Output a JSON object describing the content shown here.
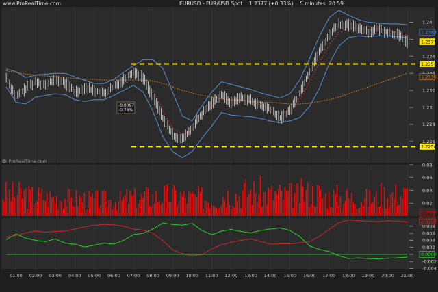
{
  "header": {
    "brand": "www.ProRealTime.com",
    "instrument": "EURUSD - EUR/USD Spot",
    "last_price_change": "1.2377 (+0.33%)",
    "timeframe": "5 minutes",
    "clock": "20:59"
  },
  "watermark": "© ProRealTime.com",
  "colors": {
    "background": "#1e1e1e",
    "panel": "#2b2b2b",
    "price_bars": "#cfcfcf",
    "bollinger": "#5b8fd8",
    "moving_average": "#c97a20",
    "signal_line": "#c83a3a",
    "support_resistance": "#ffe600",
    "volume": "#e01010",
    "green_line": "#2bd12b",
    "red_line": "#c82a2a"
  },
  "icons": [
    "prorealtime-logo"
  ],
  "chart_data": [
    {
      "type": "line",
      "panel": "price",
      "title": "EURUSD - EUR/USD Spot",
      "ylim": [
        1.2235,
        1.2418
      ],
      "yticks": [
        1.226,
        1.228,
        1.23,
        1.232,
        1.234,
        1.236,
        1.238,
        1.24
      ],
      "ytick_labels": [
        "1.226",
        "1.228",
        "1.23",
        "1.232",
        "1.234",
        "1.236",
        "1.238",
        "1.24"
      ],
      "x_labels": [
        "01:00",
        "02:00",
        "03:00",
        "04:00",
        "05:00",
        "06:00",
        "07:00",
        "08:00",
        "09:00",
        "10:00",
        "11:00",
        "12:00",
        "13:00",
        "14:00",
        "15:00",
        "16:00",
        "17:00",
        "18:00",
        "19:00",
        "20:00",
        "21:00"
      ],
      "hours": [
        0.5,
        1,
        1.5,
        2,
        2.5,
        3,
        3.5,
        4,
        4.5,
        5,
        5.5,
        6,
        6.5,
        7,
        7.5,
        8,
        8.5,
        9,
        9.5,
        10,
        10.5,
        11,
        11.5,
        12,
        12.5,
        13,
        13.5,
        14,
        14.5,
        15,
        15.5,
        16,
        16.5,
        17,
        17.5,
        18,
        18.5,
        19,
        19.5,
        20,
        20.5,
        21
      ],
      "series": [
        {
          "kind": "price",
          "values": [
            1.2335,
            1.2312,
            1.2322,
            1.2331,
            1.2326,
            1.2333,
            1.2329,
            1.2318,
            1.2323,
            1.232,
            1.2316,
            1.2324,
            1.2333,
            1.2342,
            1.2335,
            1.2312,
            1.2288,
            1.2268,
            1.2262,
            1.2276,
            1.2292,
            1.2305,
            1.2315,
            1.2305,
            1.2312,
            1.2308,
            1.2302,
            1.2298,
            1.2287,
            1.2296,
            1.2317,
            1.2342,
            1.2365,
            1.2385,
            1.2398,
            1.2396,
            1.2394,
            1.2389,
            1.2392,
            1.2388,
            1.2385,
            1.2377
          ]
        },
        {
          "kind": "bollinger-upper",
          "values": [
            1.2345,
            1.2342,
            1.2335,
            1.2338,
            1.2339,
            1.234,
            1.234,
            1.2336,
            1.2332,
            1.2328,
            1.2328,
            1.2333,
            1.2341,
            1.2349,
            1.2356,
            1.2356,
            1.2346,
            1.2318,
            1.229,
            1.2284,
            1.2302,
            1.2318,
            1.233,
            1.2327,
            1.2324,
            1.2321,
            1.2317,
            1.2314,
            1.2311,
            1.2316,
            1.2332,
            1.2357,
            1.2383,
            1.2405,
            1.2414,
            1.2408,
            1.2403,
            1.24,
            1.2399,
            1.2398,
            1.2398,
            1.2397
          ]
        },
        {
          "kind": "bollinger-lower",
          "values": [
            1.2324,
            1.2306,
            1.2304,
            1.2312,
            1.2314,
            1.2316,
            1.2315,
            1.2309,
            1.2307,
            1.2309,
            1.2309,
            1.2314,
            1.232,
            1.2326,
            1.2318,
            1.2295,
            1.2266,
            1.2248,
            1.2241,
            1.2248,
            1.2264,
            1.2278,
            1.2294,
            1.2291,
            1.229,
            1.2289,
            1.2287,
            1.2284,
            1.2282,
            1.2284,
            1.2288,
            1.2301,
            1.2322,
            1.2351,
            1.2372,
            1.2382,
            1.2384,
            1.2383,
            1.2384,
            1.2384,
            1.2383,
            1.2382
          ]
        },
        {
          "kind": "moving-average",
          "values": [
            1.2343,
            1.2341,
            1.2339,
            1.2338,
            1.2337,
            1.2336,
            1.2335,
            1.2334,
            1.2333,
            1.2333,
            1.2332,
            1.2332,
            1.2332,
            1.2332,
            1.2332,
            1.2331,
            1.2328,
            1.2324,
            1.232,
            1.2317,
            1.2314,
            1.2312,
            1.231,
            1.2309,
            1.2308,
            1.2307,
            1.2306,
            1.2306,
            1.2305,
            1.2304,
            1.2304,
            1.2305,
            1.2307,
            1.2309,
            1.2312,
            1.2316,
            1.232,
            1.2324,
            1.2328,
            1.2332,
            1.2336,
            1.234
          ]
        },
        {
          "kind": "signal",
          "values": [
            null,
            null,
            null,
            null,
            null,
            null,
            null,
            null,
            null,
            null,
            null,
            null,
            null,
            null,
            null,
            1.2322,
            1.2296,
            1.2276,
            1.2268,
            1.2273,
            1.2288,
            1.2301,
            1.231,
            1.2308,
            1.2309,
            1.2307,
            1.2303,
            1.2298,
            1.2293,
            1.2296,
            1.2309,
            1.233,
            1.2352,
            1.2373,
            1.2388,
            1.2392,
            1.2393,
            1.2391,
            1.2392,
            1.239,
            1.2388,
            1.2385
          ]
        }
      ],
      "reference_lines": [
        {
          "value": 1.2351,
          "label": "1.2351"
        },
        {
          "value": 1.2254,
          "label": "1.2254"
        }
      ],
      "price_tags": [
        "1.2388",
        "1.2377",
        "1.2336"
      ],
      "annotation": {
        "hour": 7,
        "lines": [
          "-0.0097",
          "-0.78%"
        ]
      }
    },
    {
      "type": "bar",
      "panel": "volume",
      "ylim": [
        0,
        0.08
      ],
      "yticks": [
        0.02,
        0.04,
        0.06,
        0.08
      ],
      "ytick_labels": [
        "0.02",
        "0.04",
        "0.06",
        "0.08"
      ],
      "price_tag": "0.0066",
      "hour_values": [
        0.034,
        0.031,
        0.029,
        0.027,
        0.025,
        0.024,
        0.028,
        0.03,
        0.032,
        0.029,
        0.027,
        0.034,
        0.038,
        0.034,
        0.033,
        0.036,
        0.031,
        0.029,
        0.027,
        0.034
      ]
    },
    {
      "type": "line",
      "panel": "indicator",
      "ylim": [
        -0.0043,
        0.0103
      ],
      "yticks": [
        -0.004,
        -0.002,
        0,
        0.002,
        0.004,
        0.006,
        0.008
      ],
      "ytick_labels": [
        "-0.004",
        "-0.002",
        "0.000",
        "0.002",
        "0.004",
        "0.006",
        "0.008"
      ],
      "price_tags": [
        "0.0123",
        "0.0100",
        "0.0000"
      ],
      "hours": [
        0.5,
        1,
        1.5,
        2,
        2.5,
        3,
        3.5,
        4,
        4.5,
        5,
        5.5,
        6,
        6.5,
        7,
        7.5,
        8,
        8.5,
        9,
        9.5,
        10,
        10.5,
        11,
        11.5,
        12,
        12.5,
        13,
        13.5,
        14,
        14.5,
        15,
        15.5,
        16,
        16.5,
        17,
        17.5,
        18,
        18.5,
        19,
        19.5,
        20,
        20.5,
        21
      ],
      "series": [
        {
          "color_key": "green_line",
          "values": [
            0.0042,
            0.0058,
            0.0046,
            0.004,
            0.0036,
            0.0044,
            0.0032,
            0.0029,
            0.0021,
            0.0026,
            0.0032,
            0.0029,
            0.004,
            0.0056,
            0.006,
            0.0072,
            0.0089,
            0.0085,
            0.0083,
            0.0088,
            0.0068,
            0.0056,
            0.0066,
            0.0071,
            0.0065,
            0.0061,
            0.0068,
            0.0072,
            0.0075,
            0.0068,
            0.0051,
            0.0024,
            0.0014,
            0.0008,
            -0.0004,
            -0.0012,
            -0.001,
            -0.0012,
            -0.0013,
            -0.0011,
            -0.001,
            -0.0008
          ]
        },
        {
          "color_key": "red_line",
          "values": [
            0.0049,
            0.0054,
            0.0061,
            0.0066,
            0.0063,
            0.0065,
            0.0066,
            0.0072,
            0.0078,
            0.0083,
            0.0085,
            0.0084,
            0.008,
            0.0072,
            0.0069,
            0.006,
            0.0039,
            0.0013,
            0.0002,
            -0.0004,
            -0.0001,
            0.0016,
            0.0027,
            0.0034,
            0.004,
            0.0044,
            0.0037,
            0.0029,
            0.003,
            0.003,
            0.0033,
            0.0036,
            0.0051,
            0.0071,
            0.009,
            0.0098,
            0.0096,
            0.0094,
            0.0093,
            0.0096,
            0.0094,
            0.0092
          ]
        },
        {
          "color_key": "green_line",
          "values": [
            0.0,
            0.0,
            0.0,
            0.0,
            0.0,
            0.0,
            0.0,
            0.0,
            0.0,
            0.0,
            0.0,
            0.0,
            0.0,
            0.0,
            0.0,
            0.0,
            0.0,
            0.0,
            0.0,
            0.0,
            0.0,
            0.0,
            0.0,
            0.0,
            0.0,
            0.0,
            0.0,
            0.0,
            0.0,
            0.0,
            0.0,
            0.0,
            0.0,
            0.0,
            0.0,
            0.0,
            0.0,
            0.0,
            0.0,
            0.0,
            0.0,
            0.0
          ]
        }
      ]
    }
  ]
}
